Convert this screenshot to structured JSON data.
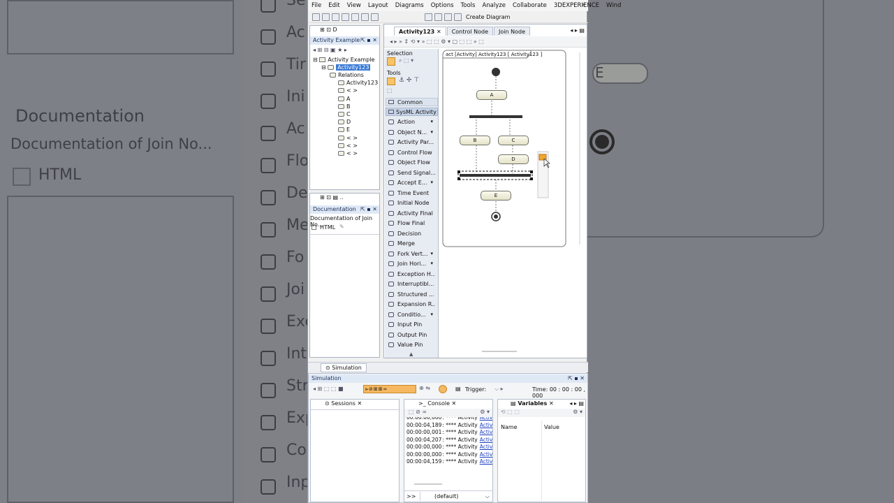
{
  "background": {
    "texts": [
      "Documentation",
      "Documentation of Join No...",
      "HTML",
      "E"
    ],
    "left_letters": [
      "Se",
      "Ac",
      "Tir",
      "Ini",
      "Ac",
      "Flo",
      "De",
      "Me",
      "Fo",
      "Joi",
      "Exc",
      "Int",
      "Str",
      "Exp",
      "Co",
      "Inp"
    ]
  },
  "menu": [
    "File",
    "Edit",
    "View",
    "Layout",
    "Diagrams",
    "Options",
    "Tools",
    "Analyze",
    "Collaborate",
    "3DEXPERIENCE",
    "Wind"
  ],
  "toolbar": {
    "create_diagram": "Create Diagram"
  },
  "tree": {
    "tabs": [
      "D"
    ],
    "title": "Activity Example",
    "root": "Activity Example",
    "selected": "Activity123",
    "items": [
      "Relations",
      "Activity123",
      "< >",
      "A",
      "B",
      "C",
      "D",
      "E",
      "< >",
      "< >",
      "< >"
    ]
  },
  "documentation": {
    "title": "Documentation",
    "text": "Documentation of Join No...",
    "html_label": "HTML"
  },
  "editor_tabs": [
    "Activity123",
    "Control Node",
    "Join Node"
  ],
  "palette": {
    "selection": "Selection",
    "tools": "Tools",
    "common": "Common",
    "sysml": "SysML Activity ...",
    "items": [
      "Action",
      "Object N...",
      "Activity Par...",
      "Control Flow",
      "Object Flow",
      "Send Signal...",
      "Accept E...",
      "Time Event",
      "Initial Node",
      "Activity Final",
      "Flow Final",
      "Decision",
      "Merge",
      "Fork Vert...",
      "Join Hori...",
      "Exception H...",
      "Interruptibl...",
      "Structured ...",
      "Expansion R...",
      "Conditio...",
      "Input Pin",
      "Output Pin",
      "Value Pin"
    ],
    "has_dropdown": [
      true,
      true,
      false,
      false,
      false,
      false,
      true,
      false,
      false,
      false,
      false,
      false,
      false,
      true,
      true,
      false,
      false,
      false,
      false,
      true,
      false,
      false,
      false
    ]
  },
  "diagram": {
    "frame_label": "act [Activity] Activity123 [ Activity123 ]",
    "nodes": [
      "A",
      "B",
      "C",
      "D",
      "E"
    ]
  },
  "simulation": {
    "tab": "Simulation",
    "title": "Simulation",
    "trigger": "Trigger:",
    "time": "Time: 00 : 00 : 00 , 000",
    "subtabs": [
      "Sessions",
      "Console",
      "Variables"
    ],
    "console_lines": [
      {
        "time": "00:00:00,000",
        "text": ": **** Activity",
        "link": "Activit"
      },
      {
        "time": "00:00:04,189",
        "text": ": **** Activity",
        "link": "Activit"
      },
      {
        "time": "00:00:00,001",
        "text": ": **** Activity",
        "link": "Activit"
      },
      {
        "time": "00:00:04,207",
        "text": ": **** Activity",
        "link": "Activit"
      },
      {
        "time": "00:00:00,000",
        "text": ": **** Activity",
        "link": "Activit"
      },
      {
        "time": "00:00:00,000",
        "text": ": **** Activity",
        "link": "Activit"
      },
      {
        "time": "00:00:04,159",
        "text": ": **** Activity",
        "link": "Activit"
      }
    ],
    "prompt": ">>",
    "default_engine": "(default)",
    "var_headers": [
      "Name",
      "Value"
    ]
  }
}
